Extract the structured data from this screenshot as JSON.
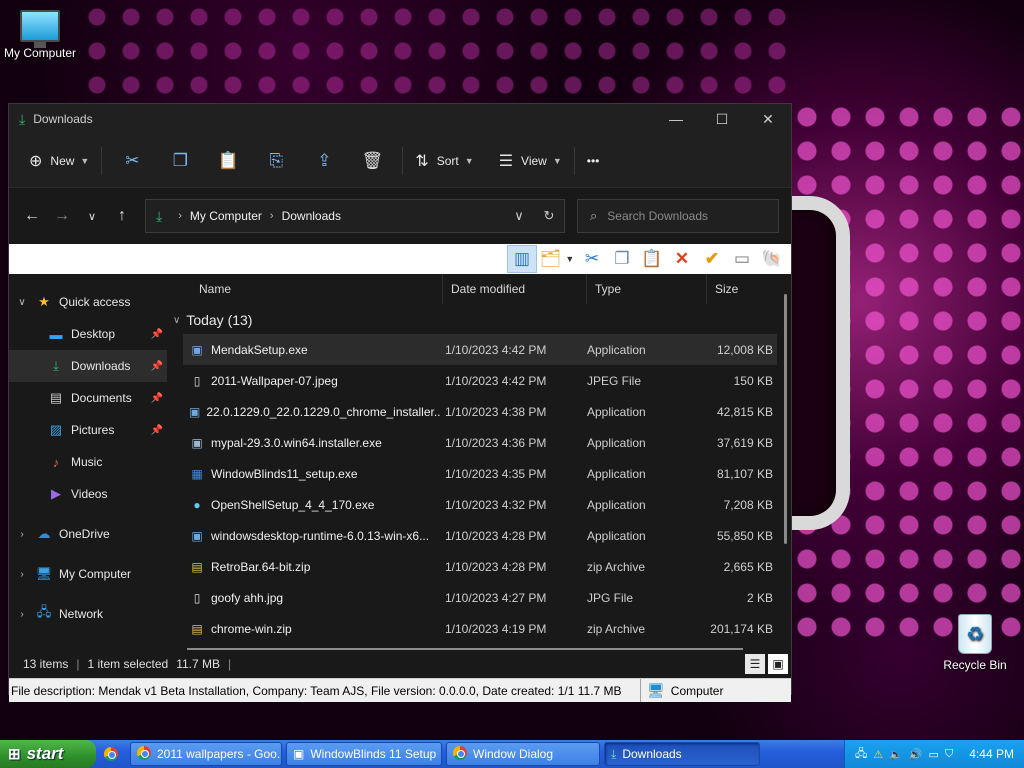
{
  "desktop": {
    "icons": [
      {
        "label": "My Computer"
      },
      {
        "label": "Recycle Bin"
      }
    ]
  },
  "window": {
    "title": "Downloads",
    "controls": {
      "minimize": "—",
      "maximize": "☐",
      "close": "✕"
    },
    "commandbar": {
      "new_label": "New",
      "sort_label": "Sort",
      "view_label": "View",
      "more_label": "•••"
    },
    "address": {
      "crumbs": [
        "My Computer",
        "Downloads"
      ]
    },
    "search": {
      "placeholder": "Search Downloads"
    },
    "nav": {
      "quick_access": "Quick access",
      "desktop": "Desktop",
      "downloads": "Downloads",
      "documents": "Documents",
      "pictures": "Pictures",
      "music": "Music",
      "videos": "Videos",
      "onedrive": "OneDrive",
      "my_computer": "My Computer",
      "network": "Network"
    },
    "columns": {
      "name": "Name",
      "date": "Date modified",
      "type": "Type",
      "size": "Size"
    },
    "group_label": "Today (13)",
    "files": [
      {
        "name": "MendakSetup.exe",
        "date": "1/10/2023 4:42 PM",
        "type": "Application",
        "size": "12,008 KB"
      },
      {
        "name": "2011-Wallpaper-07.jpeg",
        "date": "1/10/2023 4:42 PM",
        "type": "JPEG File",
        "size": "150 KB"
      },
      {
        "name": "22.0.1229.0_22.0.1229.0_chrome_installer....",
        "date": "1/10/2023 4:38 PM",
        "type": "Application",
        "size": "42,815 KB"
      },
      {
        "name": "mypal-29.3.0.win64.installer.exe",
        "date": "1/10/2023 4:36 PM",
        "type": "Application",
        "size": "37,619 KB"
      },
      {
        "name": "WindowBlinds11_setup.exe",
        "date": "1/10/2023 4:35 PM",
        "type": "Application",
        "size": "81,107 KB"
      },
      {
        "name": "OpenShellSetup_4_4_170.exe",
        "date": "1/10/2023 4:32 PM",
        "type": "Application",
        "size": "7,208 KB"
      },
      {
        "name": "windowsdesktop-runtime-6.0.13-win-x6...",
        "date": "1/10/2023 4:28 PM",
        "type": "Application",
        "size": "55,850 KB"
      },
      {
        "name": "RetroBar.64-bit.zip",
        "date": "1/10/2023 4:28 PM",
        "type": "zip Archive",
        "size": "2,665 KB"
      },
      {
        "name": "goofy ahh.jpg",
        "date": "1/10/2023 4:27 PM",
        "type": "JPG File",
        "size": "2 KB"
      },
      {
        "name": "chrome-win.zip",
        "date": "1/10/2023 4:19 PM",
        "type": "zip Archive",
        "size": "201,174 KB"
      }
    ],
    "status": {
      "items": "13 items",
      "selected": "1 item selected",
      "size": "11.7 MB",
      "divider": "|"
    },
    "classic_status": {
      "description": "File description: Mendak v1 Beta Installation, Company: Team AJS, File version: 0.0.0.0, Date created: 1/1 11.7 MB",
      "zone": "Computer"
    }
  },
  "taskbar": {
    "start_label": "start",
    "buttons": [
      {
        "label": "2011 wallpapers - Goo..."
      },
      {
        "label": "WindowBlinds 11 Setup"
      },
      {
        "label": "Window Dialog"
      },
      {
        "label": "Downloads"
      }
    ],
    "clock": "4:44 PM"
  }
}
